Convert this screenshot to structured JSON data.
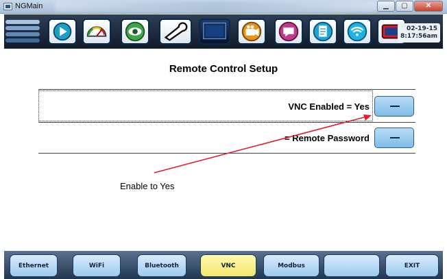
{
  "window": {
    "title": "NGMain"
  },
  "toolbar": {
    "icons": [
      "menu-icon",
      "play-icon",
      "gauge-icon",
      "eye-icon",
      "wrench-icon",
      "monitor-icon",
      "camera-icon",
      "chat-icon",
      "document-icon",
      "wifi-icon",
      "screen-icon"
    ],
    "date": "02-19-15",
    "time": "8:17:56am"
  },
  "main": {
    "title": "Remote Control Setup",
    "rows": [
      {
        "label": "VNC Enabled = Yes",
        "button_label": "−"
      },
      {
        "label": "= Remote Password",
        "button_label": "−"
      }
    ],
    "annotation": "Enable to Yes",
    "annotation_color": "#e0202a"
  },
  "tabs": [
    {
      "label": "Ethernet"
    },
    {
      "label": "WiFi"
    },
    {
      "label": "Bluetooth"
    },
    {
      "label": "VNC",
      "active": true
    },
    {
      "label": "Modbus"
    },
    {
      "label": ""
    },
    {
      "label": "EXIT"
    }
  ],
  "colors": {
    "active_tab": "#f3e66b",
    "tab": "#9ccbef",
    "toolbar": "#1a2638"
  }
}
